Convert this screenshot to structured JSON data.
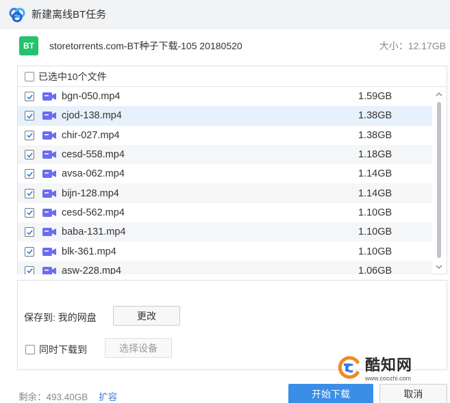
{
  "window": {
    "title": "新建离线BT任务"
  },
  "torrent": {
    "badge": "BT",
    "name": "storetorrents.com-BT种子下载-105  20180520",
    "size": "大小：12.17GB"
  },
  "file_list": {
    "header_label": "已选中10个文件",
    "items": [
      {
        "name": "bgn-050.mp4",
        "size": "1.59GB",
        "checked": true
      },
      {
        "name": "cjod-138.mp4",
        "size": "1.38GB",
        "checked": true
      },
      {
        "name": "chir-027.mp4",
        "size": "1.38GB",
        "checked": true
      },
      {
        "name": "cesd-558.mp4",
        "size": "1.18GB",
        "checked": true
      },
      {
        "name": "avsa-062.mp4",
        "size": "1.14GB",
        "checked": true
      },
      {
        "name": "bijn-128.mp4",
        "size": "1.14GB",
        "checked": true
      },
      {
        "name": "cesd-562.mp4",
        "size": "1.10GB",
        "checked": true
      },
      {
        "name": "baba-131.mp4",
        "size": "1.10GB",
        "checked": true
      },
      {
        "name": "blk-361.mp4",
        "size": "1.10GB",
        "checked": true
      },
      {
        "name": "asw-228.mp4",
        "size": "1.06GB",
        "checked": true
      }
    ]
  },
  "save": {
    "label": "保存到: 我的网盘",
    "change_button": "更改",
    "sync_label": "同时下载到",
    "device_button": "选择设备"
  },
  "footer": {
    "remaining": "剩余：493.40GB",
    "expand_link": "扩容",
    "start_button": "开始下载",
    "cancel_button": "取消"
  },
  "watermark": {
    "title": "酷知网",
    "url": "www.coozhi.com"
  },
  "colors": {
    "accent": "#3a8ee6",
    "bt_badge": "#25c26e",
    "video_icon": "#6b6cf0",
    "selected_row": "#e6f1fc"
  }
}
